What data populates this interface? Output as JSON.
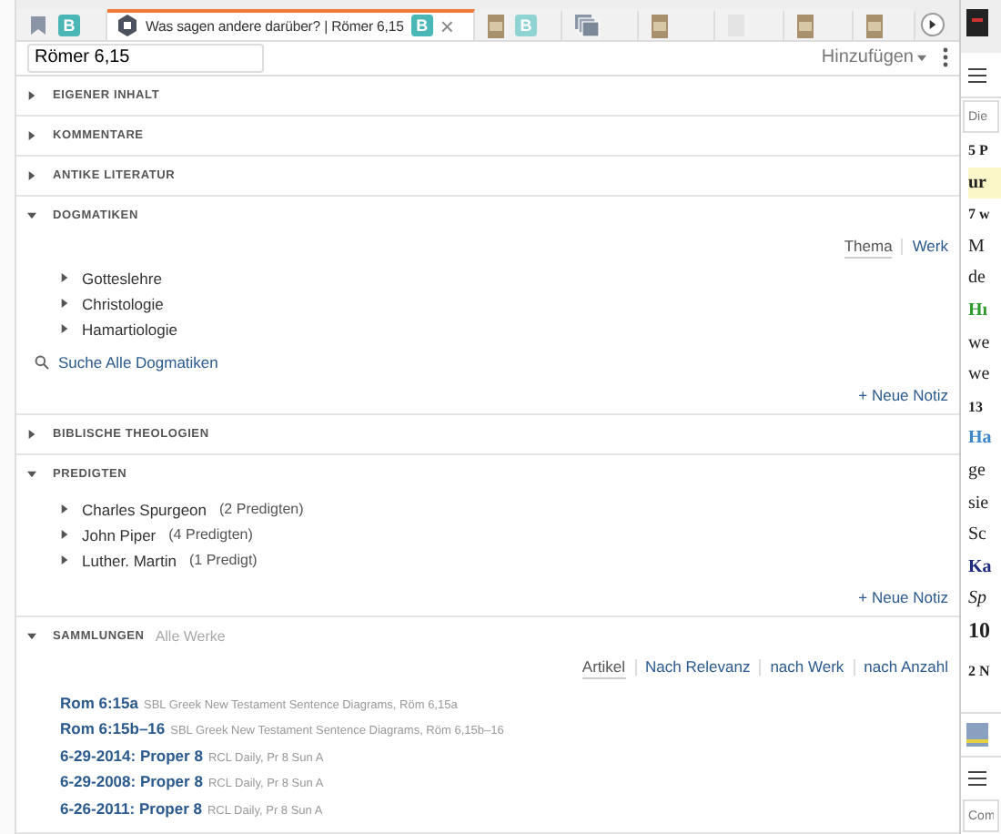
{
  "tabs": [
    {
      "kind": "home",
      "badge": "B",
      "selected": false
    },
    {
      "kind": "guide",
      "title": "Was sagen andere darüber? | Römer 6,15",
      "badge": "B",
      "close": "×",
      "selected": true
    },
    {
      "kind": "book",
      "badge": "B",
      "selected": false
    },
    {
      "kind": "stack",
      "selected": false
    },
    {
      "kind": "book",
      "selected": false
    },
    {
      "kind": "faint",
      "selected": false
    },
    {
      "kind": "book",
      "selected": false
    },
    {
      "kind": "book",
      "selected": false
    }
  ],
  "reference": {
    "value": "Römer 6,15"
  },
  "add_menu": "Hinzufügen",
  "sections": [
    {
      "title": "EIGENER INHALT",
      "expanded": false
    },
    {
      "title": "KOMMENTARE",
      "expanded": false
    },
    {
      "title": "ANTIKE LITERATUR",
      "expanded": false
    },
    {
      "title": "DOGMATIKEN",
      "expanded": true,
      "kind": "tree",
      "toggles": [
        {
          "label": "Thema",
          "selected": true
        },
        {
          "label": "Werk",
          "selected": false
        }
      ],
      "items": [
        {
          "label": "Gotteslehre"
        },
        {
          "label": "Christologie"
        },
        {
          "label": "Hamartiologie"
        }
      ],
      "search_link": "Suche Alle Dogmatiken",
      "note_link": "+ Neue Notiz"
    },
    {
      "title": "BIBLISCHE THEOLOGIEN",
      "expanded": false
    },
    {
      "title": "PREDIGTEN",
      "expanded": true,
      "kind": "tree",
      "items": [
        {
          "label": "Charles Spurgeon",
          "count": "(2 Predigten)"
        },
        {
          "label": "John Piper",
          "count": "(4 Predigten)"
        },
        {
          "label": "Luther. Martin",
          "count": "(1 Predigt)"
        }
      ],
      "note_link": "+ Neue Notiz"
    },
    {
      "title": "SAMMLUNGEN",
      "subtitle": "Alle Werke",
      "expanded": true,
      "kind": "results",
      "toggles": [
        {
          "label": "Artikel",
          "selected": true
        },
        {
          "label": "Nach Relevanz",
          "selected": false
        },
        {
          "label": "nach Werk",
          "selected": false
        },
        {
          "label": "nach Anzahl",
          "selected": false
        }
      ],
      "results": [
        {
          "link": "Rom 6:15a",
          "source": "SBL Greek New Testament Sentence Diagrams, Röm 6,15a"
        },
        {
          "link": "Rom 6:15b–16",
          "source": "SBL Greek New Testament Sentence Diagrams, Röm 6,15b–16"
        },
        {
          "link": "6-29-2014: Proper 8",
          "source": "RCL Daily, Pr 8 Sun A"
        },
        {
          "link": "6-29-2008: Proper 8",
          "source": "RCL Daily, Pr 8 Sun A"
        },
        {
          "link": "6-26-2011: Proper 8",
          "source": "RCL Daily, Pr 8 Sun A"
        }
      ]
    }
  ],
  "side_pane": {
    "search_placeholder": "Die",
    "lines": [
      {
        "text": "5 P",
        "kind": "head"
      },
      {
        "text": "ur",
        "kind": "highlight"
      },
      {
        "text": "7 w",
        "kind": "head"
      },
      {
        "text": "M",
        "kind": "body"
      },
      {
        "text": "de",
        "kind": "body"
      },
      {
        "text": "Hı",
        "kind": "green"
      },
      {
        "text": "we",
        "kind": "body"
      },
      {
        "text": "we",
        "kind": "body"
      },
      {
        "text": "13",
        "kind": "head"
      },
      {
        "text": "Ha",
        "kind": "blue"
      },
      {
        "text": "ge",
        "kind": "body"
      },
      {
        "text": "sie",
        "kind": "body"
      },
      {
        "text": "Sc",
        "kind": "body"
      },
      {
        "text": "Ka",
        "kind": "navy"
      },
      {
        "text": "Sp",
        "kind": "italic"
      },
      {
        "text": "10",
        "kind": "big"
      },
      {
        "text": "2 N",
        "kind": "head"
      }
    ],
    "comment_placeholder": "Com"
  }
}
